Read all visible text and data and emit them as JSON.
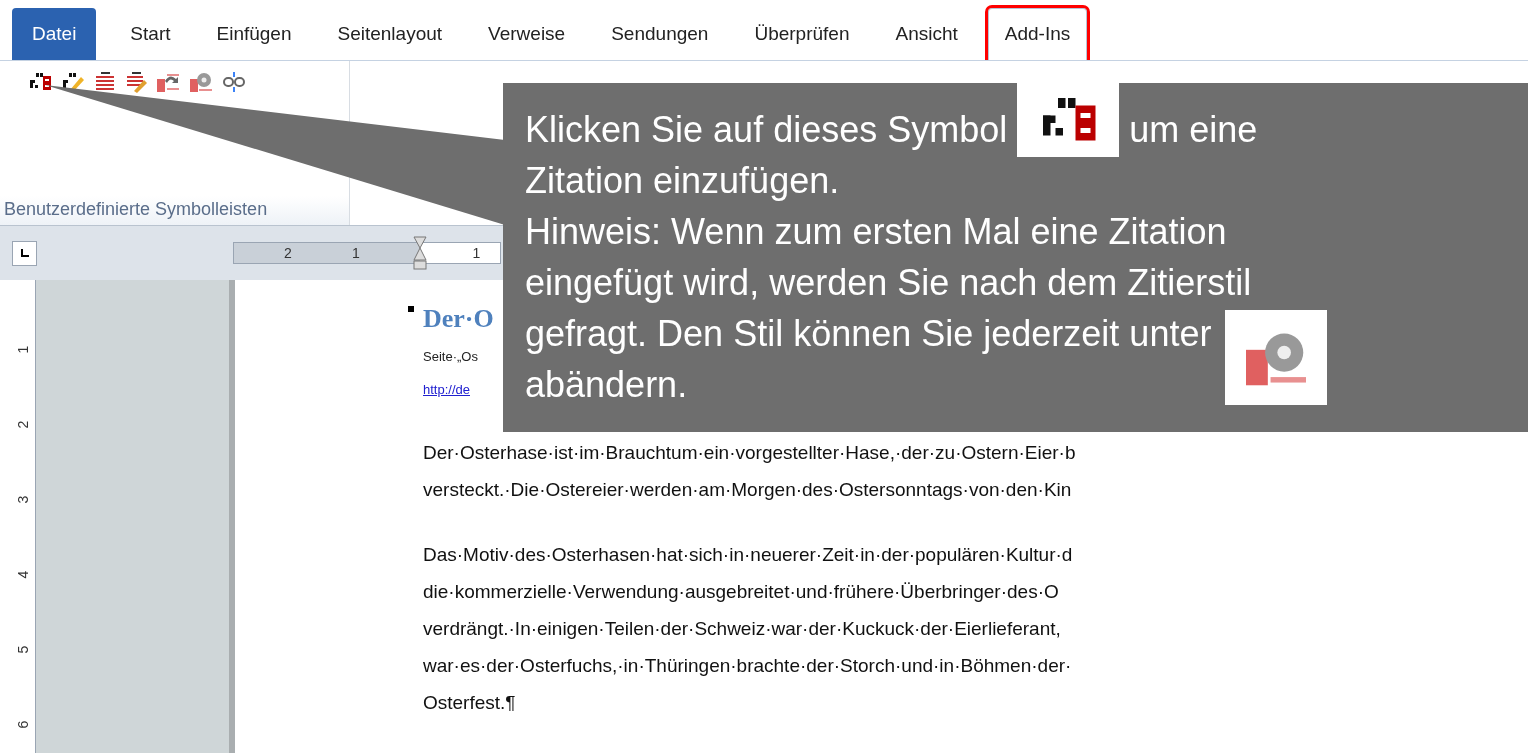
{
  "tabs": [
    {
      "label": "Datei",
      "kind": "file",
      "selected": false,
      "highlighted": false
    },
    {
      "label": "Start",
      "kind": "tab",
      "selected": false,
      "highlighted": false
    },
    {
      "label": "Einfügen",
      "kind": "tab",
      "selected": false,
      "highlighted": false
    },
    {
      "label": "Seitenlayout",
      "kind": "tab",
      "selected": false,
      "highlighted": false
    },
    {
      "label": "Verweise",
      "kind": "tab",
      "selected": false,
      "highlighted": false
    },
    {
      "label": "Sendungen",
      "kind": "tab",
      "selected": false,
      "highlighted": false
    },
    {
      "label": "Überprüfen",
      "kind": "tab",
      "selected": false,
      "highlighted": false
    },
    {
      "label": "Ansicht",
      "kind": "tab",
      "selected": false,
      "highlighted": false
    },
    {
      "label": "Add-Ins",
      "kind": "tab",
      "selected": true,
      "highlighted": true
    }
  ],
  "ribbon": {
    "group_label": "Benutzerdefinierte Symbolleisten"
  },
  "ruler": {
    "left_marks": [
      "2",
      "1"
    ],
    "right_marks": [
      "1"
    ],
    "vertical_marks": [
      "1",
      "2",
      "3",
      "4",
      "5",
      "6"
    ]
  },
  "document": {
    "heading": "Der·O",
    "source": "Seite·„Os",
    "link": "http://de",
    "paragraphs": [
      [
        "Der·Osterhase·ist·im·Brauchtum·ein·vorgestellter·Hase,·der·zu·Ostern·Eier·b",
        "versteckt.·Die·Ostereier·werden·am·Morgen·des·Ostersonntags·von·den·Kin"
      ],
      [
        "Das·Motiv·des·Osterhasen·hat·sich·in·neuerer·Zeit·in·der·populären·Kultur·d",
        "die·kommerzielle·Verwendung·ausgebreitet·und·frühere·Überbringer·des·O",
        "verdrängt.·In·einigen·Teilen·der·Schweiz·war·der·Kuckuck·der·Eierlieferant,",
        "war·es·der·Osterfuchs,·in·Thüringen·brachte·der·Storch·und·in·Böhmen·der·",
        "Osterfest.¶"
      ]
    ]
  },
  "callout": {
    "lines": [
      [
        {
          "kind": "text",
          "text": "Klicken Sie auf dieses Symbol"
        },
        {
          "kind": "citation-icon"
        },
        {
          "kind": "text",
          "text": "um eine"
        }
      ],
      [
        {
          "kind": "text",
          "text": "Zitation einzufügen."
        }
      ],
      [
        {
          "kind": "text",
          "text": "Hinweis: Wenn zum ersten Mal eine Zitation"
        }
      ],
      [
        {
          "kind": "text",
          "text": "eingefügt wird, werden Sie nach dem Zitierstil"
        }
      ],
      [
        {
          "kind": "text",
          "text": "gefragt. Den Stil können Sie jederzeit unter"
        },
        {
          "kind": "settings-icon"
        }
      ],
      [
        {
          "kind": "text",
          "text": "abändern."
        }
      ]
    ]
  }
}
